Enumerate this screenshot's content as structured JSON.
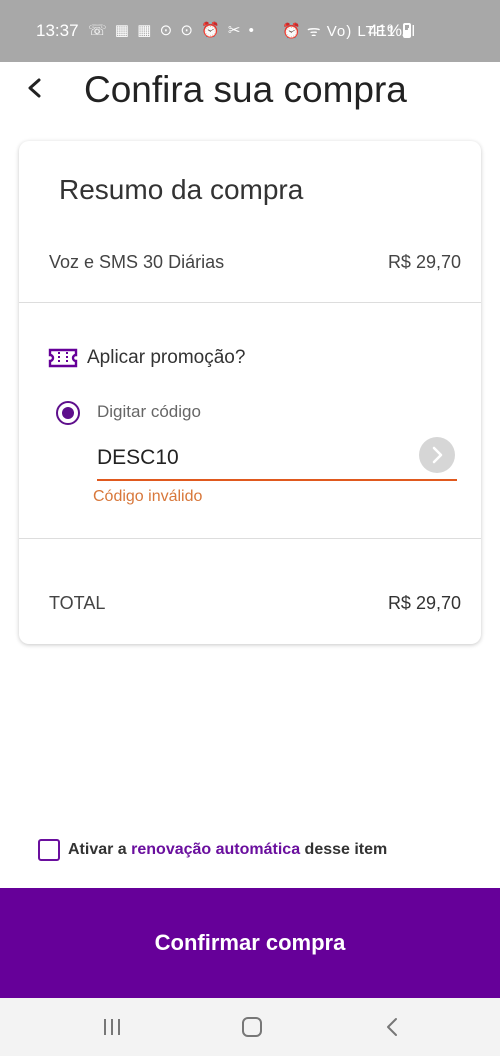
{
  "status_bar": {
    "time": "13:37",
    "left_icons": "☏ ▦ ▦ ⊙ ⊙ ⏰ ✂ •",
    "right_icons": "⏰ ᯤ Vo) LTE1 .ıl",
    "battery": "41%"
  },
  "header": {
    "title": "Confira sua compra"
  },
  "summary": {
    "title": "Resumo da compra",
    "item_name": "Voz e SMS 30 Diárias",
    "item_price": "R$ 29,70"
  },
  "promo": {
    "label": "Aplicar promoção?",
    "option_label": "Digitar código",
    "code_value": "DESC10",
    "error": "Código inválido"
  },
  "total": {
    "label": "TOTAL",
    "value": "R$ 29,70"
  },
  "renewal": {
    "prefix": "Ativar a ",
    "link": "renovação automática",
    "suffix": " desse item"
  },
  "confirm_button": {
    "label": "Confirmar compra"
  },
  "colors": {
    "brand_purple": "#660099",
    "error_orange": "#d8773a",
    "status_bar_gray": "#a8a8a8"
  },
  "icons": [
    "back-arrow-icon",
    "ticket-icon",
    "chevron-right-icon",
    "nav-recents-icon",
    "nav-home-icon",
    "nav-back-icon"
  ]
}
